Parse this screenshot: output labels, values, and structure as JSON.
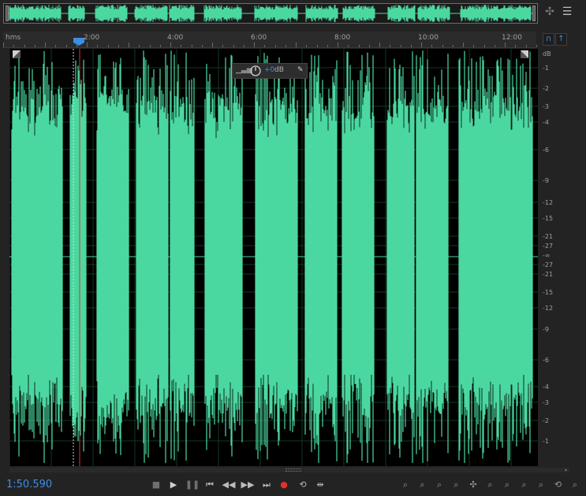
{
  "overview": {
    "waveform_color": "#4bd8a0"
  },
  "ruler": {
    "units": "hms",
    "labels": [
      "2:00",
      "4:00",
      "6:00",
      "8:00",
      "10:00",
      "12:00"
    ]
  },
  "hud": {
    "gain_value": "+0",
    "gain_unit": "dB"
  },
  "db_scale": {
    "title": "dB",
    "labels": [
      "-1",
      "-2",
      "-3",
      "-4",
      "-6",
      "-9",
      "-12",
      "-15",
      "-21",
      "-27",
      "-∞",
      "-27",
      "-21",
      "-15",
      "-12",
      "-9",
      "-6",
      "-4",
      "-3",
      "-2",
      "-1"
    ]
  },
  "waveform": {
    "color": "#4bd8a0",
    "background": "#000000",
    "playhead_color": "#e03030"
  },
  "timecode": "1:50.590",
  "transport": {
    "icons": [
      "stop-icon",
      "play-icon",
      "pause-icon",
      "skip-back-icon",
      "rewind-icon",
      "fast-forward-icon",
      "skip-forward-icon",
      "record-icon",
      "loop-icon",
      "skip-selection-icon"
    ],
    "glyphs": [
      "■",
      "▶",
      "❚❚",
      "⏮",
      "◀◀",
      "▶▶",
      "⏭",
      "●",
      "⟲",
      "⇹"
    ],
    "record_color": "#e03030"
  },
  "zoom": {
    "glyphs": [
      "⌕",
      "⌕",
      "⌕",
      "⌕",
      "✣",
      "⌕",
      "⌕",
      "⌕",
      "⌕",
      "⟲",
      "⌕"
    ],
    "icons": [
      "zoom-in-amplitude-icon",
      "zoom-out-amplitude-icon",
      "zoom-in-time-icon",
      "zoom-out-time-icon",
      "zoom-reset-icon",
      "zoom-in-point-icon",
      "zoom-out-point-icon",
      "zoom-selection-icon",
      "zoom-full-icon",
      "zoom-history-icon",
      "zoom-extra-icon"
    ]
  }
}
